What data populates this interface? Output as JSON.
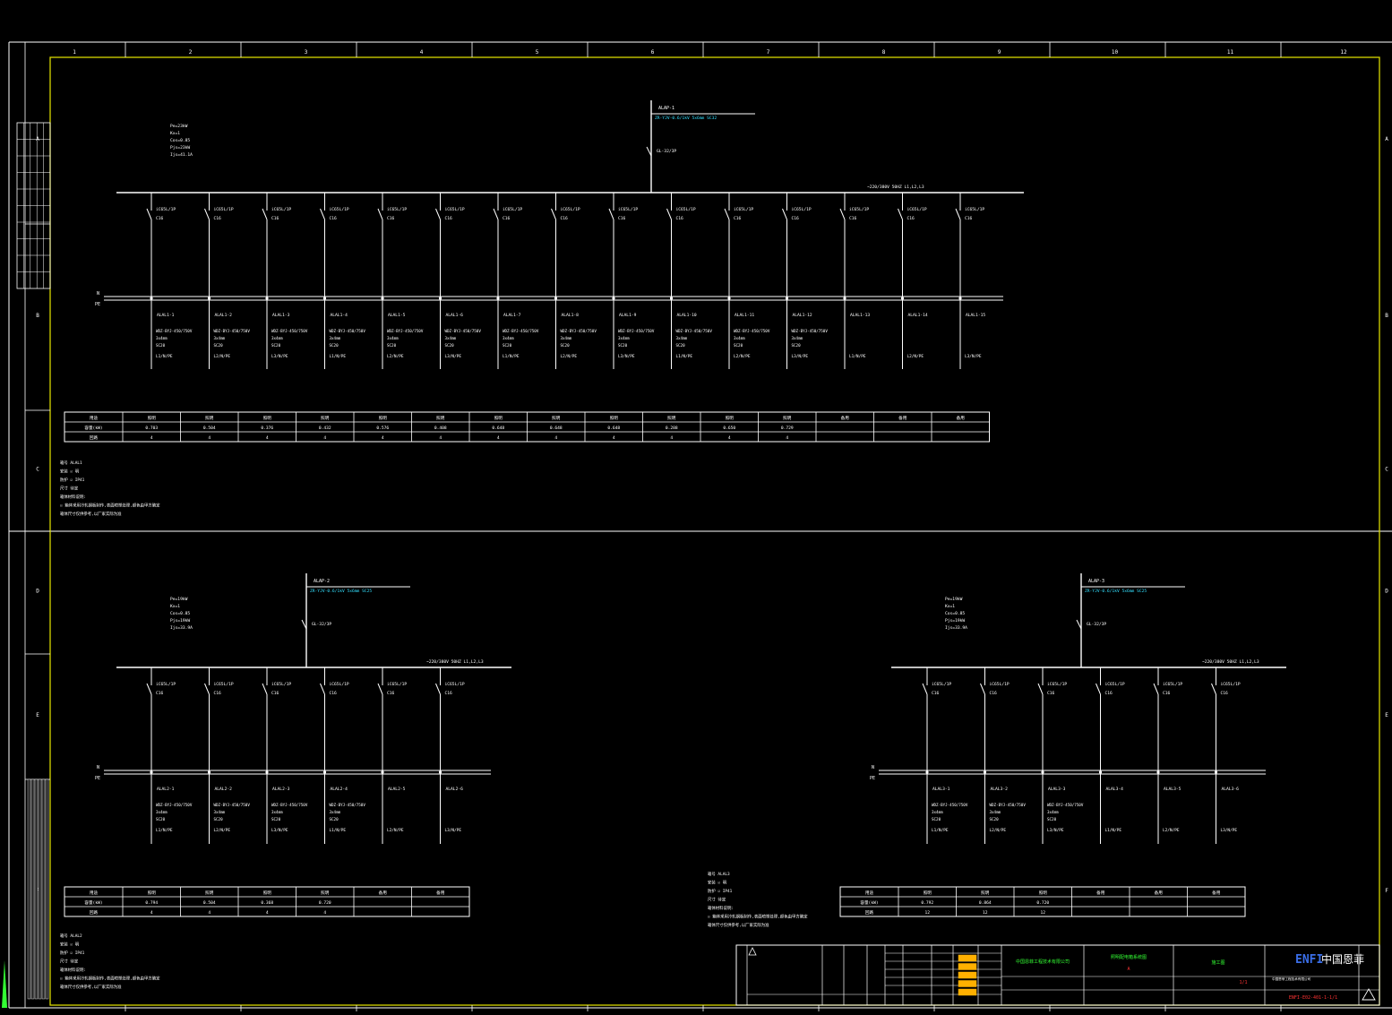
{
  "colors": {
    "background": "#000000",
    "line": "#ffffff",
    "frame": "#d8d800",
    "cyan": "#33e0ff",
    "green": "#33ff33",
    "orange": "#ffb000",
    "brand": "#3a6ee8",
    "red": "#ff3333"
  },
  "grid": {
    "cols": [
      "1",
      "2",
      "3",
      "4",
      "5",
      "6",
      "7",
      "8",
      "9",
      "10",
      "11",
      "12"
    ],
    "rows": [
      "A",
      "B",
      "C",
      "D",
      "E",
      "F"
    ]
  },
  "panels": [
    {
      "id": "panel-1",
      "params": [
        "Pe=23kW",
        "Kx=1",
        "Cos=0.85",
        "Pjs=23kW",
        "Ijs=41.1A"
      ],
      "incoming": {
        "label": "ALAP-1",
        "cable": "ZR-YJV-0.6/1kV 5x6mm SC32",
        "breaker": "GL-32/3P"
      },
      "bus_label": "~220/380V 50HZ L1,L2,L3",
      "bus_marks": [
        "N",
        "PE"
      ],
      "circuits": [
        {
          "breaker": "iC65L/1P",
          "rating": "C16",
          "name": "ALAL1-1",
          "cable": [
            "WDZ-BYJ-450/750V",
            "3x4mm",
            "SC20"
          ],
          "phase": "L1/N/PE"
        },
        {
          "breaker": "iC65L/1P",
          "rating": "C16",
          "name": "ALAL1-2",
          "cable": [
            "WDZ-BYJ-450/750V",
            "3x4mm",
            "SC20"
          ],
          "phase": "L2/N/PE"
        },
        {
          "breaker": "iC65L/1P",
          "rating": "C16",
          "name": "ALAL1-3",
          "cable": [
            "WDZ-BYJ-450/750V",
            "3x4mm",
            "SC20"
          ],
          "phase": "L3/N/PE"
        },
        {
          "breaker": "iC65L/1P",
          "rating": "C16",
          "name": "ALAL1-4",
          "cable": [
            "WDZ-BYJ-450/750V",
            "3x4mm",
            "SC20"
          ],
          "phase": "L1/N/PE"
        },
        {
          "breaker": "iC65L/1P",
          "rating": "C16",
          "name": "ALAL1-5",
          "cable": [
            "WDZ-BYJ-450/750V",
            "3x4mm",
            "SC20"
          ],
          "phase": "L2/N/PE"
        },
        {
          "breaker": "iC65L/1P",
          "rating": "C16",
          "name": "ALAL1-6",
          "cable": [
            "WDZ-BYJ-450/750V",
            "3x4mm",
            "SC20"
          ],
          "phase": "L3/N/PE"
        },
        {
          "breaker": "iC65L/1P",
          "rating": "C16",
          "name": "ALAL1-7",
          "cable": [
            "WDZ-BYJ-450/750V",
            "3x4mm",
            "SC20"
          ],
          "phase": "L1/N/PE"
        },
        {
          "breaker": "iC65L/1P",
          "rating": "C16",
          "name": "ALAL1-8",
          "cable": [
            "WDZ-BYJ-450/750V",
            "3x4mm",
            "SC20"
          ],
          "phase": "L2/N/PE"
        },
        {
          "breaker": "iC65L/1P",
          "rating": "C16",
          "name": "ALAL1-9",
          "cable": [
            "WDZ-BYJ-450/750V",
            "3x4mm",
            "SC20"
          ],
          "phase": "L3/N/PE"
        },
        {
          "breaker": "iC65L/1P",
          "rating": "C16",
          "name": "ALAL1-10",
          "cable": [
            "WDZ-BYJ-450/750V",
            "3x4mm",
            "SC20"
          ],
          "phase": "L1/N/PE"
        },
        {
          "breaker": "iC65L/1P",
          "rating": "C16",
          "name": "ALAL1-11",
          "cable": [
            "WDZ-BYJ-450/750V",
            "3x4mm",
            "SC20"
          ],
          "phase": "L2/N/PE"
        },
        {
          "breaker": "iC65L/1P",
          "rating": "C16",
          "name": "ALAL1-12",
          "cable": [
            "WDZ-BYJ-450/750V",
            "3x4mm",
            "SC20"
          ],
          "phase": "L3/N/PE"
        },
        {
          "breaker": "iC65L/1P",
          "rating": "C16",
          "name": "ALAL1-13",
          "cable": [],
          "phase": "L1/N/PE"
        },
        {
          "breaker": "iC65L/1P",
          "rating": "C16",
          "name": "ALAL1-14",
          "cable": [],
          "phase": "L2/N/PE"
        },
        {
          "breaker": "iC65L/1P",
          "rating": "C16",
          "name": "ALAL1-15",
          "cable": [],
          "phase": "L3/N/PE"
        }
      ],
      "table": {
        "row_labels": [
          "用途",
          "容量(kW)",
          "回路"
        ],
        "cols": [
          [
            "照明",
            "0.703",
            "4"
          ],
          [
            "照明",
            "0.504",
            "4"
          ],
          [
            "照明",
            "0.376",
            "4"
          ],
          [
            "照明",
            "0.432",
            "4"
          ],
          [
            "照明",
            "0.576",
            "4"
          ],
          [
            "照明",
            "0.408",
            "4"
          ],
          [
            "照明",
            "0.648",
            "4"
          ],
          [
            "照明",
            "0.648",
            "4"
          ],
          [
            "照明",
            "0.648",
            "4"
          ],
          [
            "照明",
            "0.288",
            "4"
          ],
          [
            "照明",
            "0.650",
            "4"
          ],
          [
            "照明",
            "0.729",
            "4"
          ],
          [
            "备用",
            "",
            ""
          ],
          [
            "备用",
            "",
            ""
          ],
          [
            "备用",
            "",
            ""
          ]
        ]
      },
      "notes": [
        "箱号  ALAL1",
        "安装  ☑ 明",
        "防护  ☑ IP41",
        "尺寸  待定",
        "箱体材料说明:",
        "☑ 箱体采用冷轧钢板制作,表面喷塑处理,颜色由甲方确定",
        "箱体尺寸仅供参考,以厂家实际为准"
      ]
    },
    {
      "id": "panel-2",
      "params": [
        "Pe=19kW",
        "Kx=1",
        "Cos=0.85",
        "Pjs=19kW",
        "Ijs=33.9A"
      ],
      "incoming": {
        "label": "ALAP-2",
        "cable": "ZR-YJV-0.6/1kV 5x6mm SC25",
        "breaker": "GL-32/3P"
      },
      "bus_label": "~220/380V 50HZ L1,L2,L3",
      "bus_marks": [
        "N",
        "PE"
      ],
      "circuits": [
        {
          "breaker": "iC65L/1P",
          "rating": "C16",
          "name": "ALAL2-1",
          "cable": [
            "WDZ-BYJ-450/750V",
            "3x4mm",
            "SC20"
          ],
          "phase": "L1/N/PE"
        },
        {
          "breaker": "iC65L/1P",
          "rating": "C16",
          "name": "ALAL2-2",
          "cable": [
            "WDZ-BYJ-450/750V",
            "3x4mm",
            "SC20"
          ],
          "phase": "L2/N/PE"
        },
        {
          "breaker": "iC65L/1P",
          "rating": "C16",
          "name": "ALAL2-3",
          "cable": [
            "WDZ-BYJ-450/750V",
            "3x4mm",
            "SC20"
          ],
          "phase": "L3/N/PE"
        },
        {
          "breaker": "iC65L/1P",
          "rating": "C16",
          "name": "ALAL2-4",
          "cable": [
            "WDZ-BYJ-450/750V",
            "3x4mm",
            "SC20"
          ],
          "phase": "L1/N/PE"
        },
        {
          "breaker": "iC65L/1P",
          "rating": "C16",
          "name": "ALAL2-5",
          "cable": [],
          "phase": "L2/N/PE"
        },
        {
          "breaker": "iC65L/1P",
          "rating": "C16",
          "name": "ALAL2-6",
          "cable": [],
          "phase": "L3/N/PE"
        }
      ],
      "table": {
        "row_labels": [
          "用途",
          "容量(kW)",
          "回路"
        ],
        "cols": [
          [
            "照明",
            "0.794",
            "4"
          ],
          [
            "照明",
            "0.504",
            "4"
          ],
          [
            "照明",
            "0.368",
            "4"
          ],
          [
            "照明",
            "0.720",
            "4"
          ],
          [
            "备用",
            "",
            ""
          ],
          [
            "备用",
            "",
            ""
          ]
        ]
      },
      "notes": [
        "箱号  ALAL2",
        "安装  ☑ 明",
        "防护  ☑ IP41",
        "尺寸  待定",
        "箱体材料说明:",
        "☑ 箱体采用冷轧钢板制作,表面喷塑处理,颜色由甲方确定",
        "箱体尺寸仅供参考,以厂家实际为准"
      ]
    },
    {
      "id": "panel-3",
      "params": [
        "Pe=19kW",
        "Kx=1",
        "Cos=0.85",
        "Pjs=19kW",
        "Ijs=33.9A"
      ],
      "incoming": {
        "label": "ALAP-3",
        "cable": "ZR-YJV-0.6/1kV 5x6mm SC25",
        "breaker": "GL-32/3P"
      },
      "bus_label": "~220/380V 50HZ L1,L2,L3",
      "bus_marks": [
        "N",
        "PE"
      ],
      "circuits": [
        {
          "breaker": "iC65L/1P",
          "rating": "C16",
          "name": "ALAL3-1",
          "cable": [
            "WDZ-BYJ-450/750V",
            "3x4mm",
            "SC20"
          ],
          "phase": "L1/N/PE"
        },
        {
          "breaker": "iC65L/1P",
          "rating": "C16",
          "name": "ALAL3-2",
          "cable": [
            "WDZ-BYJ-450/750V",
            "3x4mm",
            "SC20"
          ],
          "phase": "L2/N/PE"
        },
        {
          "breaker": "iC65L/1P",
          "rating": "C16",
          "name": "ALAL3-3",
          "cable": [
            "WDZ-BYJ-450/750V",
            "3x4mm",
            "SC20"
          ],
          "phase": "L3/N/PE"
        },
        {
          "breaker": "iC65L/1P",
          "rating": "C16",
          "name": "ALAL3-4",
          "cable": [],
          "phase": "L1/N/PE"
        },
        {
          "breaker": "iC65L/1P",
          "rating": "C16",
          "name": "ALAL3-5",
          "cable": [],
          "phase": "L2/N/PE"
        },
        {
          "breaker": "iC65L/1P",
          "rating": "C16",
          "name": "ALAL3-6",
          "cable": [],
          "phase": "L3/N/PE"
        }
      ],
      "table": {
        "row_labels": [
          "用途",
          "容量(kW)",
          "回路"
        ],
        "cols": [
          [
            "照明",
            "0.792",
            "12"
          ],
          [
            "照明",
            "0.864",
            "12"
          ],
          [
            "照明",
            "0.720",
            "12"
          ],
          [
            "备用",
            "",
            ""
          ],
          [
            "备用",
            "",
            ""
          ],
          [
            "备用",
            "",
            ""
          ]
        ]
      },
      "notes": [
        "箱号  ALAL3",
        "安装  ☑ 明",
        "防护  ☑ IP41",
        "尺寸  待定",
        "箱体材料说明:",
        "☑ 箱体采用冷轧钢板制作,表面喷塑处理,颜色由甲方确定",
        "箱体尺寸仅供参考,以厂家实际为准"
      ]
    }
  ],
  "title_block": {
    "brand_latin": "ENFI",
    "brand_cn": "中国恩菲",
    "company": "中国恩菲工程技术有限公司",
    "project": "照明配电箱系统图",
    "drawing_no": "ENFI-E02-401-1-1/1",
    "sheet": "1/1",
    "stage": "施工图",
    "revision": "A"
  }
}
